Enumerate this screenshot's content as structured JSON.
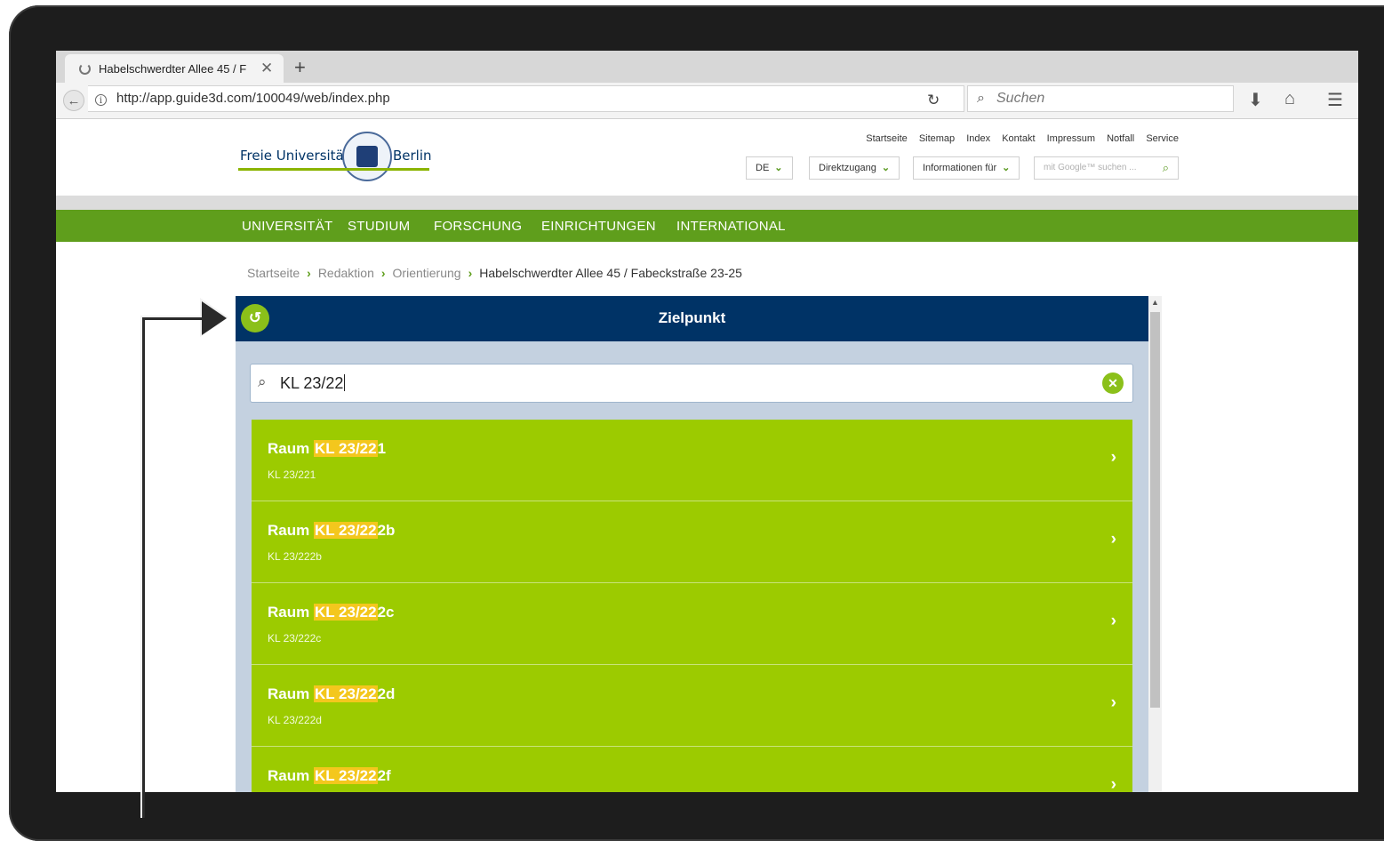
{
  "browser": {
    "tab_title": "Habelschwerdter Allee 45 / F",
    "url": "http://app.guide3d.com/100049/web/index.php",
    "search_placeholder": "Suchen"
  },
  "site": {
    "logo_left": "Freie Universität",
    "logo_right": "Berlin",
    "service_links": [
      "Startseite",
      "Sitemap",
      "Index",
      "Kontakt",
      "Impressum",
      "Notfall",
      "Service"
    ],
    "lang": "DE",
    "direktzugang": "Direktzugang",
    "informationen": "Informationen für",
    "google_placeholder": "mit Google™ suchen ...",
    "main_nav": [
      "UNIVERSITÄT",
      "STUDIUM",
      "FORSCHUNG",
      "EINRICHTUNGEN",
      "INTERNATIONAL"
    ],
    "breadcrumb": [
      "Startseite",
      "Redaktion",
      "Orientierung",
      "Habelschwerdter Allee 45 / Fabeckstraße 23-25"
    ]
  },
  "widget": {
    "title": "Zielpunkt",
    "query": "KL 23/22",
    "results": [
      {
        "prefix": "Raum ",
        "match": "KL 23/22",
        "rest": "1",
        "sub": "KL 23/221"
      },
      {
        "prefix": "Raum ",
        "match": "KL 23/22",
        "rest": "2b",
        "sub": "KL 23/222b"
      },
      {
        "prefix": "Raum ",
        "match": "KL 23/22",
        "rest": "2c",
        "sub": "KL 23/222c"
      },
      {
        "prefix": "Raum ",
        "match": "KL 23/22",
        "rest": "2d",
        "sub": "KL 23/222d"
      },
      {
        "prefix": "Raum ",
        "match": "KL 23/22",
        "rest": "2f",
        "sub": ""
      }
    ]
  },
  "colors": {
    "nav_green": "#5f9e1c",
    "header_blue": "#003366",
    "result_green": "#9ccb00",
    "highlight": "#f4c71d"
  }
}
